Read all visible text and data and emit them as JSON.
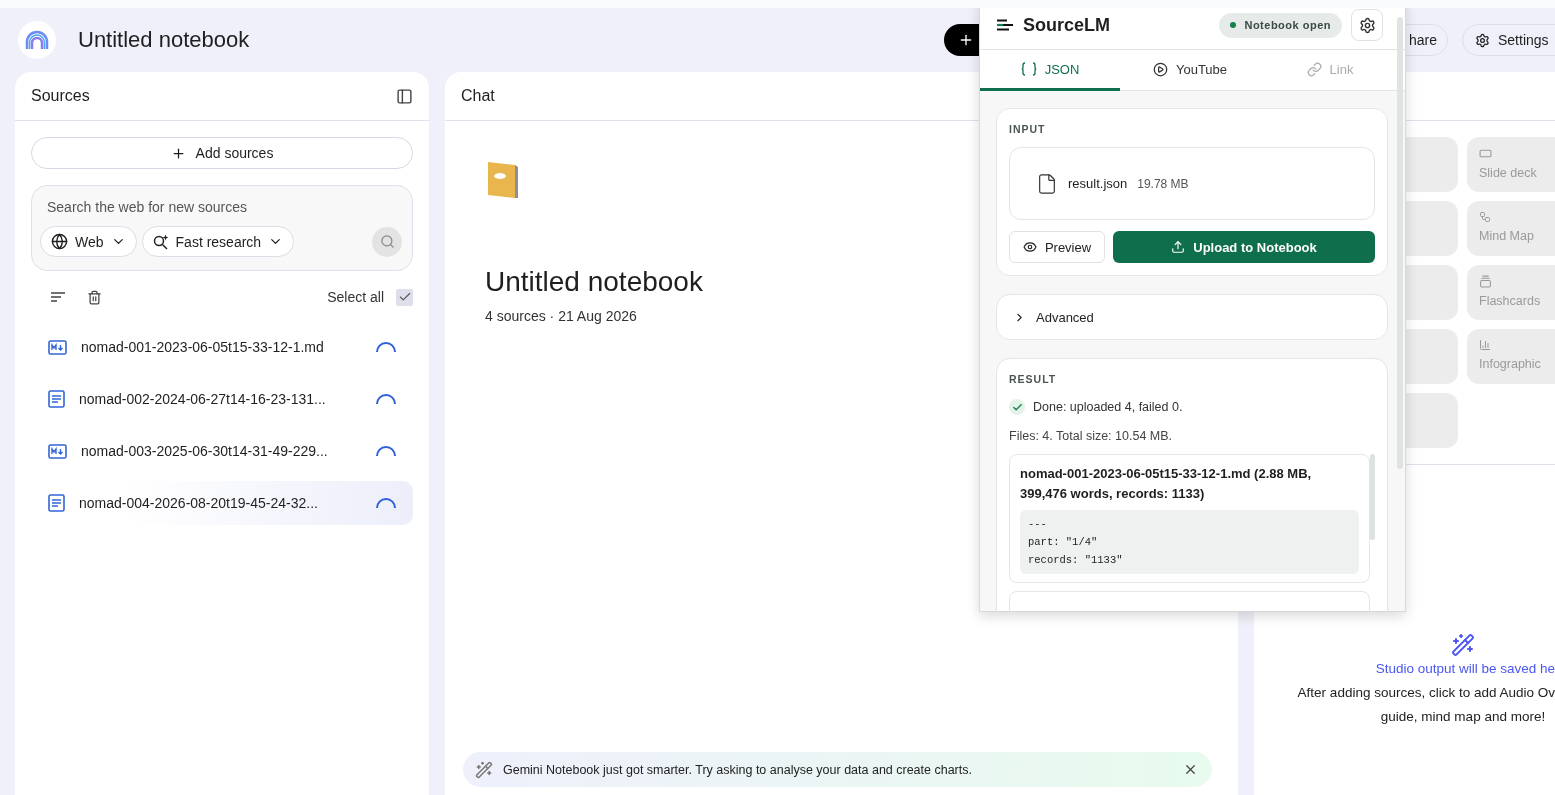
{
  "header": {
    "title": "Untitled notebook",
    "share_label": "hare",
    "settings_label": "Settings"
  },
  "sources": {
    "title": "Sources",
    "add_label": "Add sources",
    "search": {
      "placeholder": "Search the web for new sources",
      "chips": [
        {
          "label": "Web",
          "kind": "web"
        },
        {
          "label": "Fast research",
          "kind": "research"
        }
      ]
    },
    "select_all": {
      "label": "Select all",
      "checked": true
    },
    "items": [
      {
        "name": "nomad-001-2023-06-05t15-33-12-1.md",
        "kind": "markdown",
        "loading": true,
        "selected": false
      },
      {
        "name": "nomad-002-2024-06-27t14-16-23-131...",
        "kind": "text",
        "loading": true,
        "selected": false
      },
      {
        "name": "nomad-003-2025-06-30t14-31-49-229...",
        "kind": "markdown",
        "loading": true,
        "selected": false
      },
      {
        "name": "nomad-004-2026-08-20t19-45-24-32...",
        "kind": "text",
        "loading": true,
        "selected": true
      }
    ]
  },
  "chat": {
    "title": "Chat",
    "notebook_title": "Untitled notebook",
    "meta": "4 sources · 21 Aug 2026",
    "banner": "Gemini Notebook just got smarter. Try asking to analyse your data and create charts."
  },
  "studio": {
    "tiles": [
      {
        "kind": "blank"
      },
      {
        "kind": "slides",
        "label": "Slide deck"
      },
      {
        "kind": "blank"
      },
      {
        "kind": "mindmap",
        "label": "Mind Map"
      },
      {
        "kind": "blank"
      },
      {
        "kind": "flashcards",
        "label": "Flashcards"
      },
      {
        "kind": "blank"
      },
      {
        "kind": "infographic",
        "label": "Infographic"
      },
      {
        "kind": "blank"
      }
    ],
    "empty_state": {
      "heading": "Studio output will be saved he",
      "lines": [
        "After adding sources, click to add Audio Ov",
        "guide, mind map and more!"
      ]
    }
  },
  "extension": {
    "title": "SourceLM",
    "status": "Notebook open",
    "tabs": [
      {
        "label": "JSON",
        "kind": "json",
        "selected": true,
        "disabled": false
      },
      {
        "label": "YouTube",
        "kind": "youtube",
        "selected": false,
        "disabled": false
      },
      {
        "label": "Link",
        "kind": "link",
        "selected": false,
        "disabled": true
      }
    ],
    "input": {
      "label": "INPUT",
      "file_name": "result.json",
      "file_size": "19.78 MB",
      "preview_label": "Preview",
      "upload_label": "Upload to Notebook"
    },
    "advanced": {
      "label": "Advanced",
      "expanded": false
    },
    "result": {
      "label": "RESULT",
      "status": "Done: uploaded 4, failed 0.",
      "summary": "Files: 4. Total size: 10.54 MB.",
      "items": [
        {
          "title": "nomad-001-2023-06-05t15-33-12-1.md (2.88 MB, 399,476 words, records: 1133)",
          "code": [
            "---",
            "part: \"1/4\"",
            "records: \"1133\""
          ]
        }
      ]
    }
  }
}
